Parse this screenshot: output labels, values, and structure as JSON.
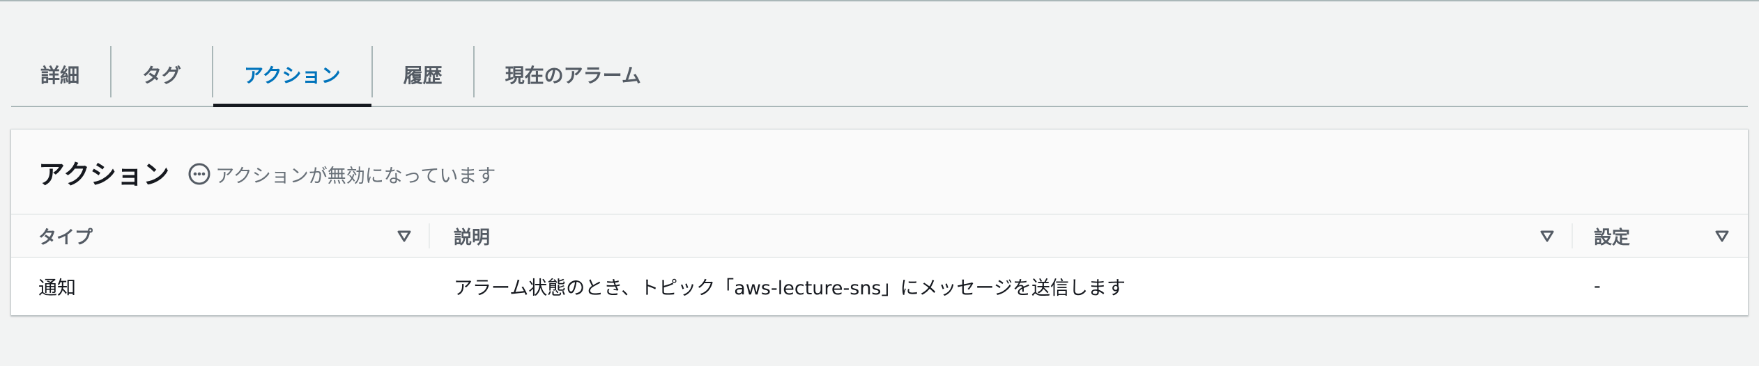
{
  "tabs": [
    {
      "label": "詳細",
      "active": false
    },
    {
      "label": "タグ",
      "active": false
    },
    {
      "label": "アクション",
      "active": true
    },
    {
      "label": "履歴",
      "active": false
    },
    {
      "label": "現在のアラーム",
      "active": false
    }
  ],
  "panel": {
    "title": "アクション",
    "status_icon": "ellipsis-circle-icon",
    "status_text": "アクションが無効になっています"
  },
  "table": {
    "columns": [
      "タイプ",
      "説明",
      "設定"
    ],
    "rows": [
      [
        "通知",
        "アラーム状態のとき、トピック「aws-lecture-sns」にメッセージを送信します",
        "-"
      ]
    ]
  },
  "colors": {
    "active_tab": "#0073bb",
    "tab_text": "#545b64",
    "background": "#f2f3f3"
  }
}
